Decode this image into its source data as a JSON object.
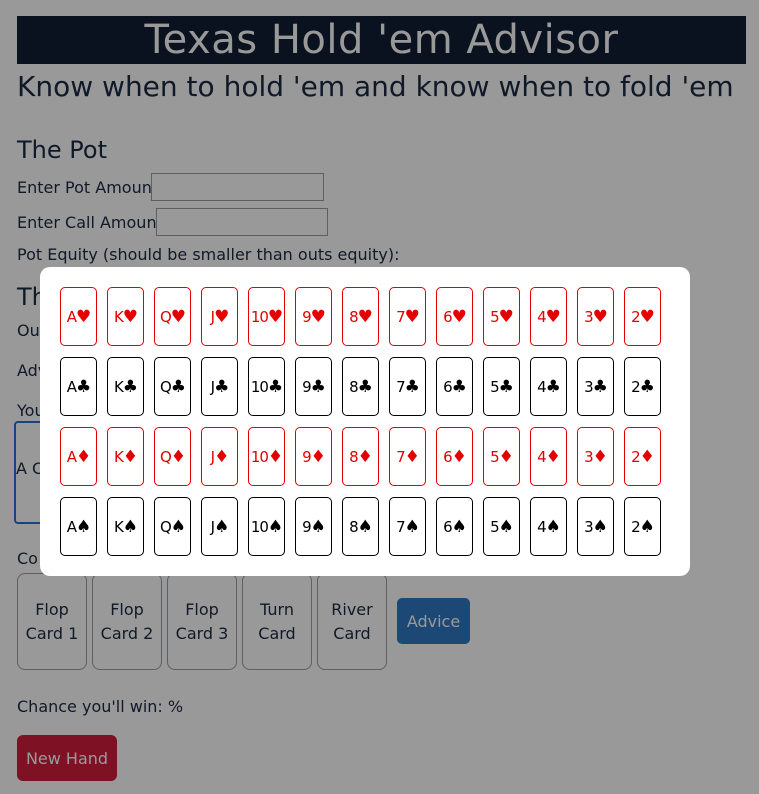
{
  "header": {
    "title": "Texas Hold 'em Advisor",
    "subtitle": "Know when to hold 'em and know when to fold 'em"
  },
  "pot": {
    "title": "The Pot",
    "pot_label": "Enter Pot Amount",
    "call_label": "Enter Call Amount",
    "equity_label": "Pot Equity (should be smaller than outs equity):"
  },
  "hand": {
    "title_partial": "Th",
    "outs_partial": "Ou",
    "advice_partial": "Adv",
    "your_partial": "You",
    "hidden_card_text": "A C",
    "community_partial": "Co"
  },
  "community_cards": [
    {
      "line1": "Flop",
      "line2": "Card 1"
    },
    {
      "line1": "Flop",
      "line2": "Card 2"
    },
    {
      "line1": "Flop",
      "line2": "Card 3"
    },
    {
      "line1": "Turn",
      "line2": "Card"
    },
    {
      "line1": "River",
      "line2": "Card"
    }
  ],
  "advice_button": "Advice",
  "chance_text": "Chance you'll win: %",
  "new_hand_button": "New Hand",
  "picker": {
    "ranks": [
      "A",
      "K",
      "Q",
      "J",
      "10",
      "9",
      "8",
      "7",
      "6",
      "5",
      "4",
      "3",
      "2"
    ],
    "suits": [
      {
        "name": "hearts",
        "symbol": "♥",
        "color": "#e50000"
      },
      {
        "name": "clubs",
        "symbol": "♣",
        "color": "#000000"
      },
      {
        "name": "diamonds",
        "symbol": "♦",
        "color": "#e50000"
      },
      {
        "name": "spades",
        "symbol": "♠",
        "color": "#000000"
      }
    ]
  }
}
